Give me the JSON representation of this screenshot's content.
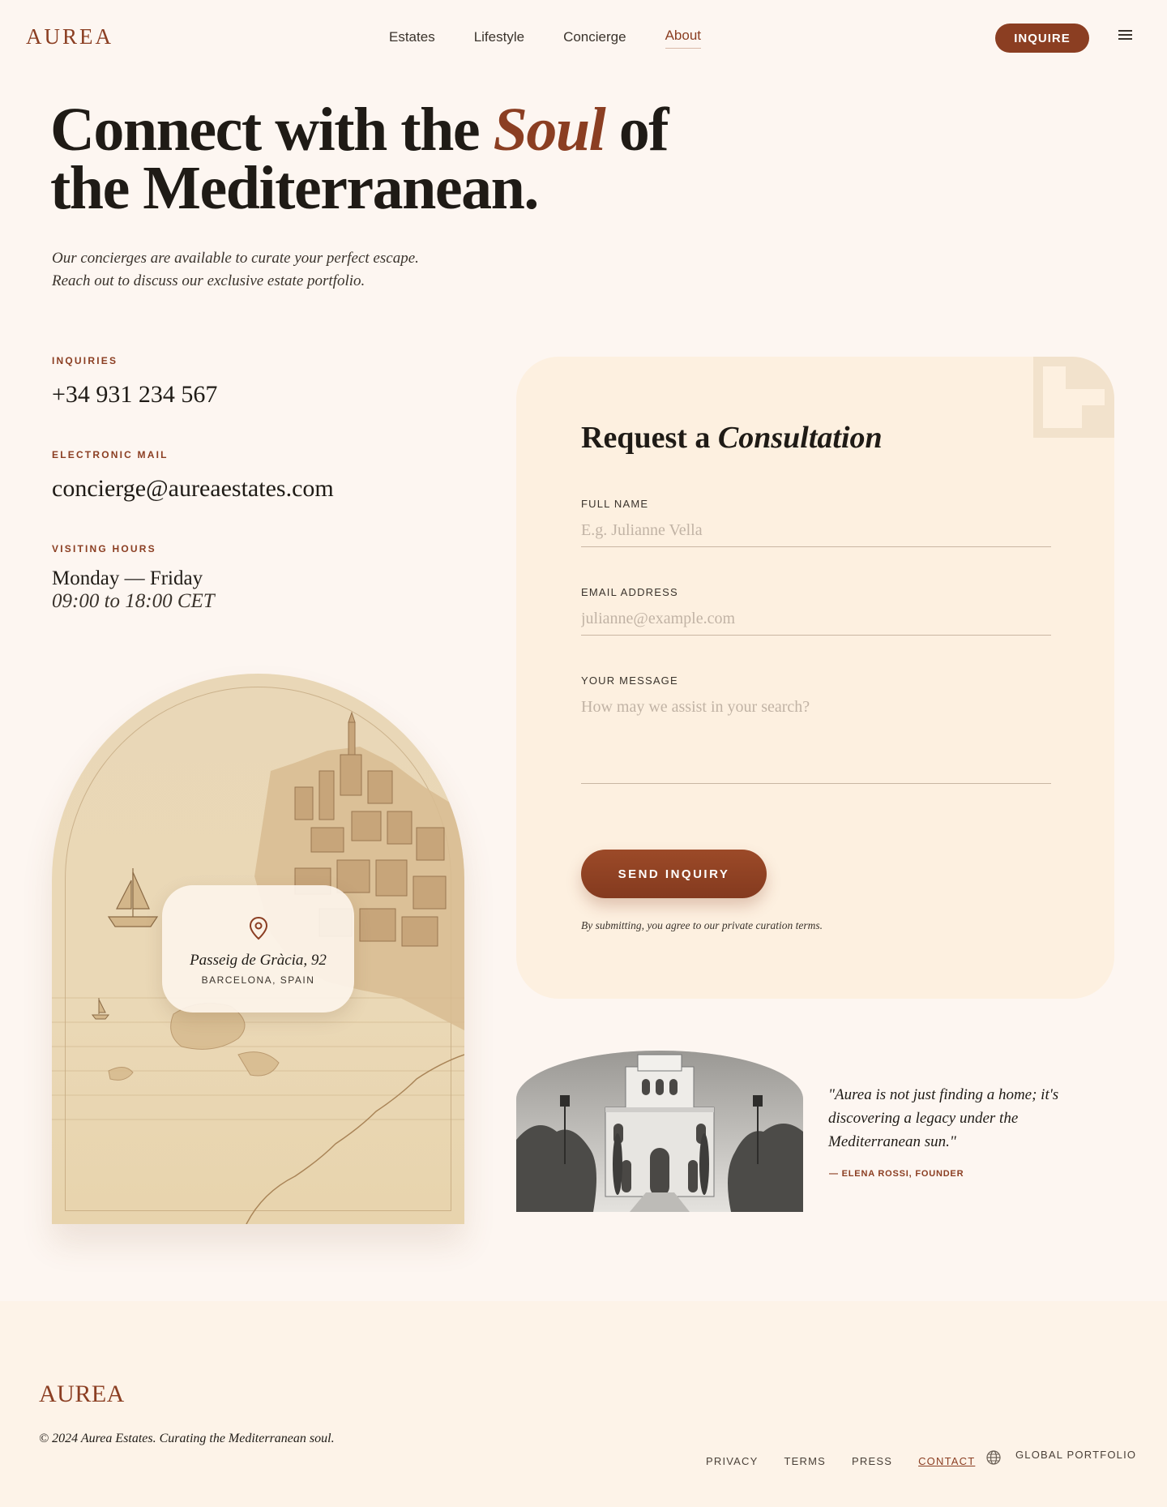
{
  "header": {
    "logo": "AUREA",
    "nav": [
      {
        "label": "Estates"
      },
      {
        "label": "Lifestyle"
      },
      {
        "label": "Concierge"
      },
      {
        "label": "About"
      }
    ],
    "active_nav": "About",
    "inquire_label": "INQUIRE",
    "menu_icon": "hamburger-menu-icon"
  },
  "hero": {
    "title_part1": "Connect with the ",
    "title_emphasis": "Soul",
    "title_part2": " of the Mediterranean.",
    "subtitle_line1": "Our concierges are available to curate your perfect escape.",
    "subtitle_line2": "Reach out to discuss our exclusive estate portfolio."
  },
  "contact": {
    "inquiries_label": "INQUIRIES",
    "phone": "+34 931 234 567",
    "email_label": "ELECTRONIC MAIL",
    "email": "concierge@aureaestates.com",
    "hours_label": "VISITING HOURS",
    "hours_days": "Monday — Friday",
    "hours_time": "09:00 to 18:00 CET"
  },
  "location": {
    "icon": "map-pin-icon",
    "street": "Passeig de Gràcia, 92",
    "city": "BARCELONA, SPAIN"
  },
  "form": {
    "title_part1": "Request a ",
    "title_emphasis": "Consultation",
    "name_label": "FULL NAME",
    "name_value": "",
    "name_placeholder": "E.g. Julianne Vella",
    "email_label": "EMAIL ADDRESS",
    "email_value": "",
    "email_placeholder": "julianne@example.com",
    "message_label": "YOUR MESSAGE",
    "message_value": "",
    "message_placeholder": "How may we assist in your search?",
    "submit_label": "SEND INQUIRY",
    "terms": "By submitting, you agree to our private curation terms."
  },
  "testimonial": {
    "quote": "\"Aurea is not just finding a home; it's discovering a legacy under the Mediterranean sun.\"",
    "author": "— ELENA ROSSI, FOUNDER"
  },
  "footer": {
    "logo": "AUREA",
    "copyright": "© 2024 Aurea Estates. Curating the Mediterranean soul.",
    "links": [
      {
        "label": "PRIVACY"
      },
      {
        "label": "TERMS"
      },
      {
        "label": "PRESS"
      },
      {
        "label": "CONTACT"
      }
    ],
    "current_link": "CONTACT",
    "globe_icon": "globe-icon",
    "global_label": "GLOBAL PORTFOLIO"
  },
  "colors": {
    "accent": "#8b3e22",
    "background": "#fdf6f1",
    "card": "#fdf0e0",
    "text": "#1f1b16"
  }
}
